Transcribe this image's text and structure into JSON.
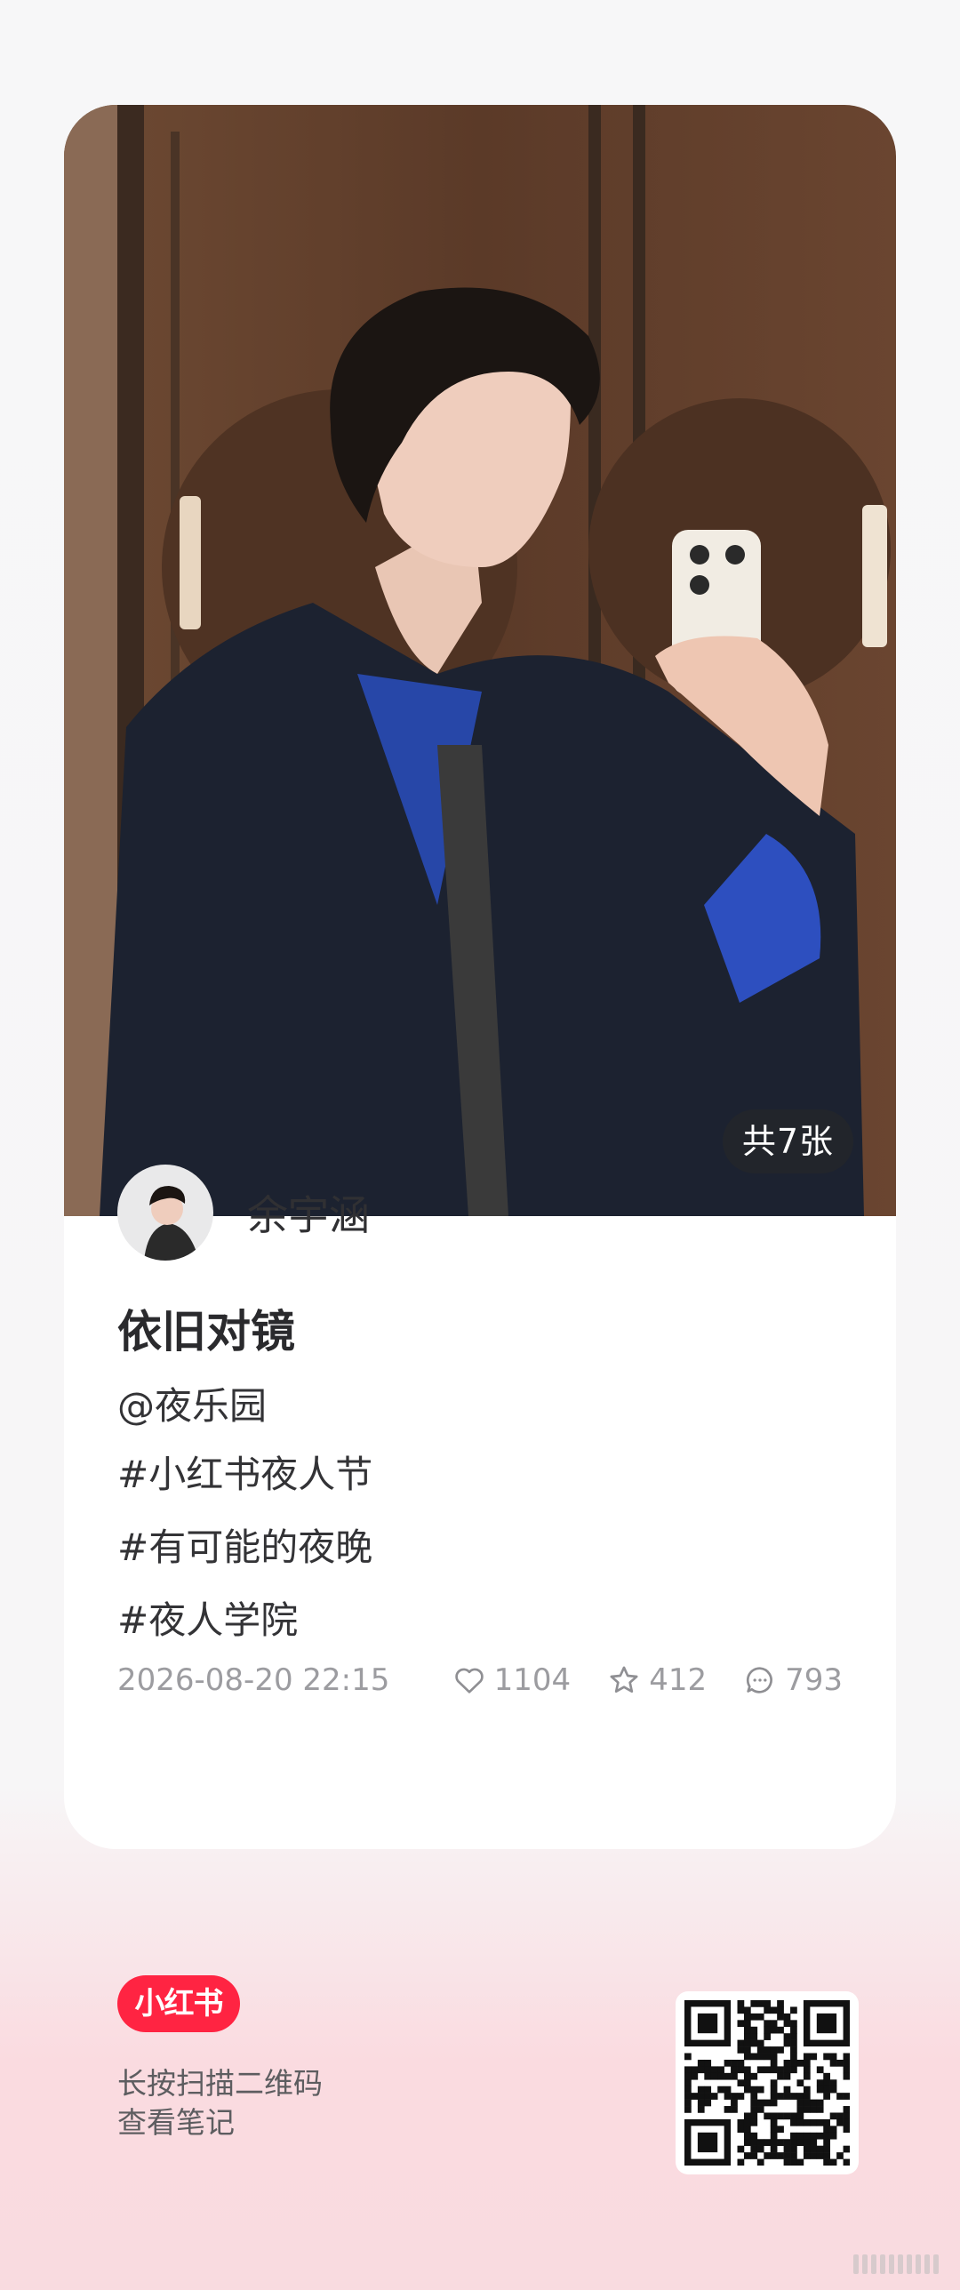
{
  "post": {
    "image_count_label": "共7张",
    "author": {
      "name": "余宇涵"
    },
    "title": "依旧对镜",
    "mention": "@夜乐园",
    "tags": [
      "#小红书夜人节",
      "#有可能的夜晚",
      "#夜人学院"
    ],
    "date": "2026-08-20 22:15",
    "stats": {
      "likes": "1104",
      "collects": "412",
      "comments": "793"
    }
  },
  "footer": {
    "brand": "小红书",
    "hint_line1": "长按扫描二维码",
    "hint_line2": "查看笔记"
  },
  "colors": {
    "brand": "#ff2442",
    "text_primary": "#2a2a2d",
    "text_muted": "#9c9ca0"
  },
  "icons": [
    "heart-icon",
    "star-icon",
    "comment-icon"
  ]
}
